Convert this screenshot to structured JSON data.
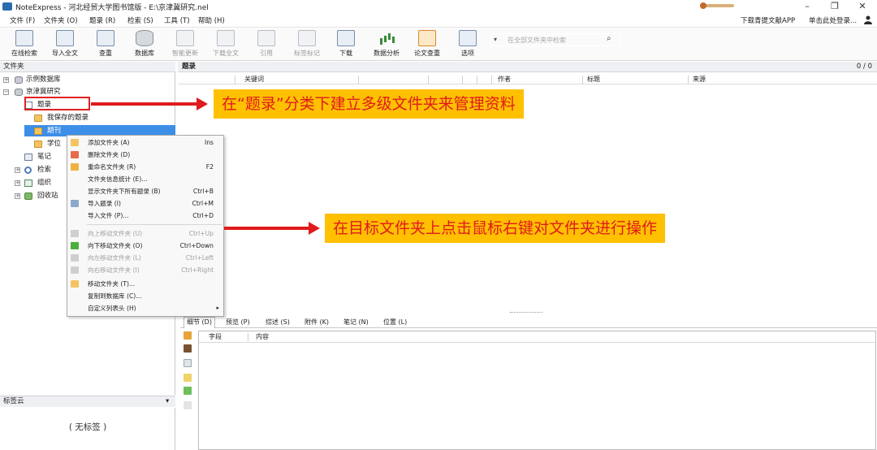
{
  "window": {
    "title": "NoteExpress - 河北经贸大学图书馆版 - E:\\京津冀研究.nel",
    "minimize": "–",
    "maximize": "❐",
    "close": "✕"
  },
  "menubar": {
    "items": [
      "文件 (F)",
      "文件夹 (O)",
      "题录 (R)",
      "检索 (S)",
      "工具 (T)",
      "帮助 (H)"
    ],
    "download_app": "下载青提文献APP",
    "login": "单击此处登录..."
  },
  "toolbar": {
    "buttons": [
      "在线检索",
      "导入全文",
      "查重",
      "数据库",
      "智能更新",
      "下载全文",
      "引用",
      "标签标记",
      "下载",
      "数据分析",
      "论文查重",
      "选项"
    ],
    "search_placeholder": "在全部文件夹中检索"
  },
  "left_panel": {
    "header": "文件夹",
    "tree": [
      "示例数据库",
      "京津冀研究",
      "题录",
      "我保存的题录",
      "期刊",
      "学位",
      "笔记",
      "检索",
      "组织",
      "回收站"
    ],
    "tag_header": "标签云",
    "tag_empty": "( 无标签 )"
  },
  "main": {
    "header": "题录",
    "count": "0 / 0",
    "columns": [
      "关键词",
      "作者",
      "标题",
      "来源"
    ]
  },
  "detail": {
    "tabs": [
      "细节 (D)",
      "预览 (P)",
      "综述 (S)",
      "附件 (K)",
      "笔记 (N)",
      "位置 (L)"
    ],
    "grid_columns": [
      "字段",
      "内容"
    ]
  },
  "context_menu": {
    "items": [
      {
        "label": "添加文件夹 (A)",
        "shortcut": "Ins",
        "enabled": true
      },
      {
        "label": "删除文件夹 (D)",
        "shortcut": "",
        "enabled": true
      },
      {
        "label": "重命名文件夹 (R)",
        "shortcut": "F2",
        "enabled": true
      },
      {
        "label": "文件夹信息统计 (E)...",
        "shortcut": "",
        "enabled": true
      },
      {
        "label": "显示文件夹下所有题录 (B)",
        "shortcut": "Ctrl+B",
        "enabled": true
      },
      {
        "label": "导入题录 (I)",
        "shortcut": "Ctrl+M",
        "enabled": true
      },
      {
        "label": "导入文件 (P)...",
        "shortcut": "Ctrl+D",
        "enabled": true
      },
      {
        "label": "向上移动文件夹 (U)",
        "shortcut": "Ctrl+Up",
        "enabled": false
      },
      {
        "label": "向下移动文件夹 (O)",
        "shortcut": "Ctrl+Down",
        "enabled": true
      },
      {
        "label": "向左移动文件夹 (L)",
        "shortcut": "Ctrl+Left",
        "enabled": false
      },
      {
        "label": "向右移动文件夹 (I)",
        "shortcut": "Ctrl+Right",
        "enabled": false
      },
      {
        "label": "移动文件夹 (T)...",
        "shortcut": "",
        "enabled": true
      },
      {
        "label": "复制到数据库 (C)...",
        "shortcut": "",
        "enabled": true
      },
      {
        "label": "自定义列表头 (H)",
        "shortcut": "",
        "enabled": true
      }
    ],
    "submenu_arrow": "▸"
  },
  "annotations": {
    "callout_1": "在“题录”分类下建立多级文件夹来管理资料",
    "callout_2": "在目标文件夹上点击鼠标右键对文件夹进行操作"
  },
  "colors": {
    "accent": "#3d8ee6",
    "annotation_red": "#e01b1b",
    "callout_bg": "#ffc000"
  }
}
